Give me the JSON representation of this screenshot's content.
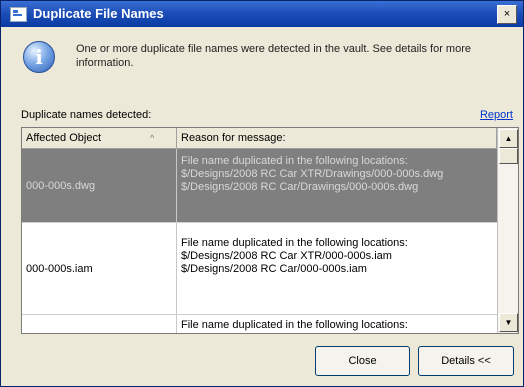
{
  "dialog": {
    "title": "Duplicate File Names",
    "close_glyph": "×",
    "info_glyph": "i",
    "message": "One or more duplicate file names were detected in the vault. See details for more information."
  },
  "section": {
    "label": "Duplicate names detected:",
    "report_link": "Report"
  },
  "grid": {
    "columns": [
      "Affected Object",
      "Reason for message:"
    ],
    "sort_glyph": "^",
    "rows": [
      {
        "object": "000-000s.dwg",
        "reason": "File name duplicated in the following locations:\n$/Designs/2008 RC Car XTR/Drawings/000-000s.dwg\n$/Designs/2008 RC Car/Drawings/000-000s.dwg",
        "selected": true
      },
      {
        "object": "000-000s.iam",
        "reason": "File name duplicated in the following locations:\n$/Designs/2008 RC Car XTR/000-000s.iam\n$/Designs/2008 RC Car/000-000s.iam",
        "selected": false
      },
      {
        "object": "",
        "reason": "File name duplicated in the following locations:",
        "selected": false
      }
    ],
    "scroll_up_glyph": "▲",
    "scroll_down_glyph": "▼"
  },
  "buttons": {
    "close": "Close",
    "details": "Details <<"
  }
}
